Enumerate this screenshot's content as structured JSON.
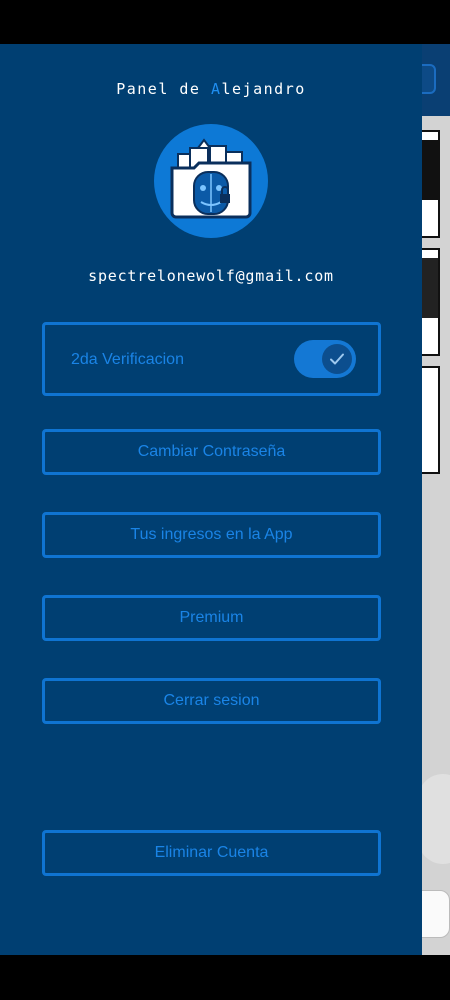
{
  "drawer": {
    "title_prefix": "Panel de ",
    "title_accent": "A",
    "title_suffix": "lejandro",
    "email": "spectrelonewolf@gmail.com",
    "two_factor": {
      "label": "2da Verificacion",
      "enabled": true
    },
    "buttons": {
      "change_password": "Cambiar Contraseña",
      "app_logins": "Tus ingresos en la App",
      "premium": "Premium",
      "logout": "Cerrar sesion",
      "delete_account": "Eliminar Cuenta"
    }
  },
  "colors": {
    "drawer_bg": "#003f72",
    "accent": "#1a84e6",
    "button_border": "#0f74d2"
  },
  "icons": {
    "logo": "folder-security-logo-icon",
    "toggle_check": "check-icon"
  }
}
